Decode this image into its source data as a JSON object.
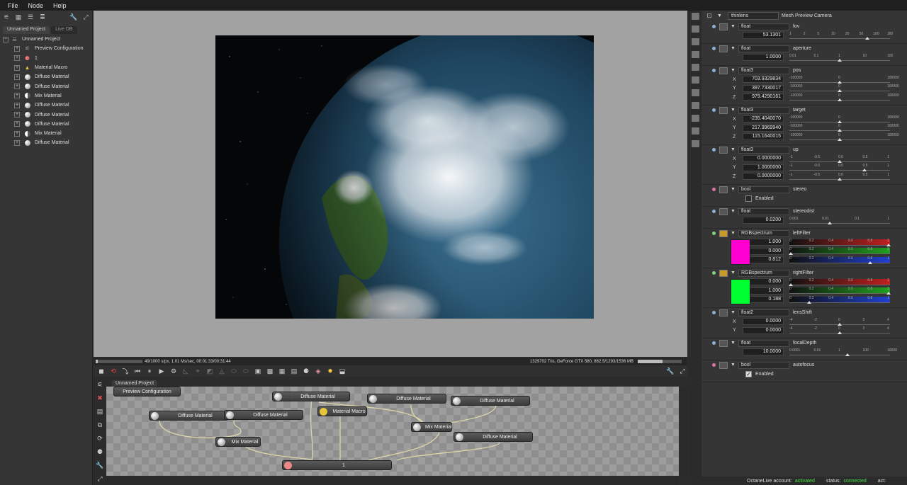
{
  "menu": {
    "file": "File",
    "node": "Node",
    "help": "Help"
  },
  "left": {
    "tabs": [
      "Unnamed Project",
      "Live DB"
    ],
    "root": "Unnamed Project",
    "items": [
      {
        "label": "Preview Configuration",
        "icon": "preview-config-icon"
      },
      {
        "label": "1",
        "icon": "camera-node-icon"
      },
      {
        "label": "Material Macro",
        "icon": "material-macro-icon"
      },
      {
        "label": "Diffuse Material",
        "icon": "diffuse-material-icon"
      },
      {
        "label": "Diffuse Material",
        "icon": "diffuse-material-icon"
      },
      {
        "label": "Mix Material",
        "icon": "mix-material-icon"
      },
      {
        "label": "Diffuse Material",
        "icon": "diffuse-material-icon"
      },
      {
        "label": "Diffuse Material",
        "icon": "diffuse-material-icon"
      },
      {
        "label": "Diffuse Material",
        "icon": "diffuse-material-icon"
      },
      {
        "label": "Mix Material",
        "icon": "mix-material-icon"
      },
      {
        "label": "Diffuse Material",
        "icon": "diffuse-material-icon"
      }
    ]
  },
  "status": {
    "left": "49/1000 s/px, 1.01 Ms/sec, 00:01:33/00:31:44",
    "right": "1329702 Tris, GeForce GTX 580, 862.5/1293/1536 MB",
    "progress": 0.049,
    "memory": 0.56
  },
  "nodegraph": {
    "tab": "Unnamed Project",
    "nodes": {
      "preview": "Preview Configuration",
      "dm1": "Diffuse Material",
      "dm2": "Diffuse Material",
      "dm3": "Diffuse Material",
      "dm4": "Diffuse Material",
      "dm5": "Diffuse Material",
      "dm6": "Diffuse Material",
      "macro": "Material Macro",
      "mix1": "Mix Material",
      "mix2": "Mix Material",
      "out": "1"
    }
  },
  "right": {
    "camera_type": "thinlens",
    "node_name": "Mesh Preview Camera",
    "props": {
      "fov": {
        "type": "float",
        "name": "fov",
        "value": "53.1301",
        "ticks": [
          "1",
          "2",
          "5",
          "10",
          "20",
          "50",
          "100",
          "180"
        ]
      },
      "aperture": {
        "type": "float",
        "name": "aperture",
        "value": "1.0000",
        "ticks": [
          "0.01",
          "0.1",
          "1",
          "10",
          "100"
        ]
      },
      "pos": {
        "type": "float3",
        "name": "pos",
        "x": "703.9329834",
        "y": "397.7330017",
        "z": "979.4290161",
        "ticks": [
          "-100000",
          "0",
          "100000"
        ]
      },
      "target": {
        "type": "float3",
        "name": "target",
        "x": "-235.4040070",
        "y": "217.9969940",
        "z": "115.1640015",
        "ticks": [
          "-100000",
          "0",
          "100000"
        ]
      },
      "up": {
        "type": "float3",
        "name": "up",
        "x": "0.0000000",
        "y": "1.0000000",
        "z": "0.0000000",
        "ticks": [
          "-1",
          "-0.5",
          "0.0",
          "0.5",
          "1"
        ]
      },
      "stereo": {
        "type": "bool",
        "name": "stereo",
        "label": "Enabled",
        "checked": false
      },
      "stereodist": {
        "type": "float",
        "name": "stereodist",
        "value": "0.0200",
        "ticks": [
          "0.001",
          "0.01",
          "0.1",
          "1"
        ]
      },
      "leftFilter": {
        "type": "RGBspectrum",
        "name": "leftFilter",
        "r": "1.000",
        "g": "0.000",
        "b": "0.812",
        "color": "#ff00d0"
      },
      "rightFilter": {
        "type": "RGBspectrum",
        "name": "rightFilter",
        "r": "0.000",
        "g": "1.000",
        "b": "0.188",
        "color": "#00ff30"
      },
      "lensShift": {
        "type": "float2",
        "name": "lensShift",
        "x": "0.0000",
        "y": "0.0000",
        "ticks": [
          "-4",
          "-2",
          "0",
          "2",
          "4"
        ]
      },
      "focalDepth": {
        "type": "float",
        "name": "focalDepth",
        "value": "10.0000",
        "ticks": [
          "0.0001",
          "0.01",
          "1",
          "100",
          "10000"
        ]
      },
      "autofocus": {
        "type": "bool",
        "name": "autofocus",
        "label": "Enabled",
        "checked": true
      }
    },
    "rgb_ticks": [
      "0",
      "0.2",
      "0.4",
      "0.6",
      "0.8",
      "1"
    ]
  },
  "footer": {
    "account_label": "OctaneLive account:",
    "account_value": "activated",
    "status_label": "status:",
    "status_value": "connected",
    "act_label": "act:"
  }
}
